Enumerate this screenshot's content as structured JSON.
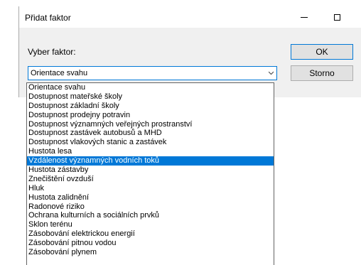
{
  "dialog": {
    "title": "Přidat faktor",
    "prompt_label": "Vyber faktor:",
    "selected_value": "Orientace svahu",
    "ok_label": "OK",
    "cancel_label": "Storno"
  },
  "icons": {
    "minimize": "minimize-icon",
    "maximize": "maximize-icon",
    "close": "close-icon",
    "dropdown": "chevron-down-icon"
  },
  "dropdown": {
    "highlighted_index": 9,
    "options": [
      "Orientace svahu",
      "Dostupnost mateřské školy",
      "Dostupnost základní školy",
      "Dostupnost prodejny potravin",
      "Dostupnost významných veřejných prostranství",
      "Dostupnost zastávek autobusů a MHD",
      "Dostupnost vlakových stanic a zastávek",
      "Hustota lesa",
      "Vzdálenost významných vodních toků",
      "Hustota zástavby",
      "Znečištění ovzduší",
      "Hluk",
      "Hustota zalidnění",
      "Radonové riziko",
      "Ochrana kulturních a sociálních prvků",
      "Sklon terénu",
      "Zásobování elektrickou energií",
      "Zásobování pitnou vodou",
      "Zásobování plynem"
    ]
  },
  "colors": {
    "selection": "#0078d7",
    "dialog_bg": "#f0f0f0"
  }
}
